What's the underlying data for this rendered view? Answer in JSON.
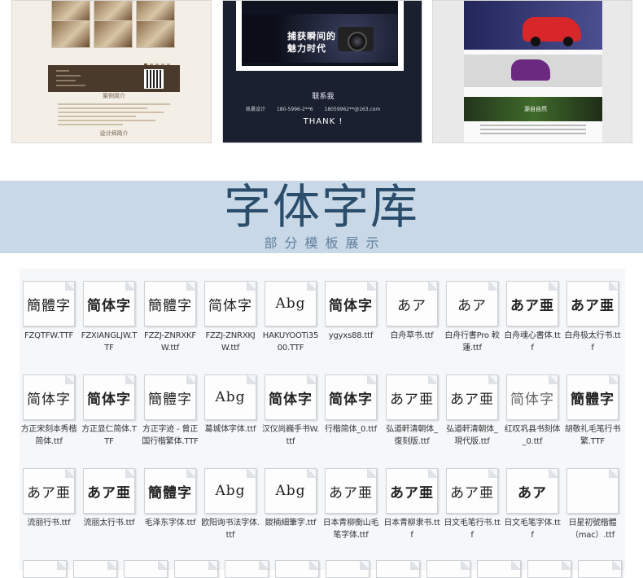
{
  "thumbnails": {
    "hotel": {
      "section_title": "案例简介",
      "footer_title": "设计师简介"
    },
    "camera": {
      "banner_text": "捕获瞬间的魅力时代",
      "contact_title": "联系我",
      "contact_name": "凯晨设计",
      "contact_phone": "180-5996-2**6",
      "contact_email": "18059962**@163.com",
      "thanks": "THANK !"
    },
    "car": {
      "section_label": "源自自然"
    }
  },
  "section": {
    "title": "字体字库",
    "subtitle": "部分模板展示"
  },
  "fonts": [
    {
      "sample": "簡體字",
      "style": "serif",
      "name": "FZQTFW.TTF"
    },
    {
      "sample": "简体字",
      "style": "bold",
      "name": "FZXIANGLJW.TTF"
    },
    {
      "sample": "簡體字",
      "style": "serif",
      "name": "FZZJ-ZNRXKFW.ttf"
    },
    {
      "sample": "简体字",
      "style": "serif",
      "name": "FZZJ-ZNRXKJW.ttf"
    },
    {
      "sample": "Abg",
      "style": "serif",
      "name": "HAKUYOOTi3500.TTF"
    },
    {
      "sample": "简体字",
      "style": "bold",
      "name": "ygyxs88.ttf"
    },
    {
      "sample": "あア",
      "style": "serif",
      "name": "白舟草书.ttf"
    },
    {
      "sample": "あア",
      "style": "serif",
      "name": "白舟行書Pro 較蓮.ttf"
    },
    {
      "sample": "あア亜",
      "style": "bold",
      "name": "白舟魂心書体.ttf"
    },
    {
      "sample": "あア亜",
      "style": "bold",
      "name": "白舟极太行书.ttf"
    },
    {
      "sample": "简体字",
      "style": "serif",
      "name": "方正宋刻本秀楷简体.ttf"
    },
    {
      "sample": "简体字",
      "style": "bold",
      "name": "方正显仁简体.TTF"
    },
    {
      "sample": "簡體字",
      "style": "serif",
      "name": "方正字迹 - 曾正国行楷繁体.TTF"
    },
    {
      "sample": "Abg",
      "style": "serif",
      "name": "葛城体字体.ttf"
    },
    {
      "sample": "简体字",
      "style": "bold",
      "name": "汉仪尚巍手书W.ttf"
    },
    {
      "sample": "简体字",
      "style": "bold",
      "name": "行楷简体_0.ttf"
    },
    {
      "sample": "あア亜",
      "style": "serif",
      "name": "弘道軒清朝体_復刻版.ttf"
    },
    {
      "sample": "あア亜",
      "style": "serif",
      "name": "弘道軒清朝体_現代版.ttf"
    },
    {
      "sample": "简体字",
      "style": "light",
      "name": "红叹巩县书刻体_0.ttf"
    },
    {
      "sample": "簡體字",
      "style": "bold",
      "name": "胡敬礼毛笔行书繁.TTF"
    },
    {
      "sample": "あア亜",
      "style": "serif",
      "name": "流丽行书.ttf"
    },
    {
      "sample": "あア亜",
      "style": "bold",
      "name": "流丽太行书.ttf"
    },
    {
      "sample": "簡體字",
      "style": "bold",
      "name": "毛泽东字体.ttf"
    },
    {
      "sample": "Abg",
      "style": "serif",
      "name": "欧阳询书法字体.ttf"
    },
    {
      "sample": "Abg",
      "style": "serif",
      "name": "鍐楠細筆字.ttf"
    },
    {
      "sample": "あア亜",
      "style": "serif",
      "name": "日本青柳衡山毛笔字体.ttf"
    },
    {
      "sample": "あア亜",
      "style": "bold",
      "name": "日本青柳隶书.ttf"
    },
    {
      "sample": "あア亜",
      "style": "serif",
      "name": "日文毛笔行书.ttf"
    },
    {
      "sample": "あア",
      "style": "bold",
      "name": "日文毛笔字体.ttf"
    },
    {
      "sample": "",
      "style": "light",
      "name": "日星初號楷體（mac）.ttf"
    }
  ]
}
